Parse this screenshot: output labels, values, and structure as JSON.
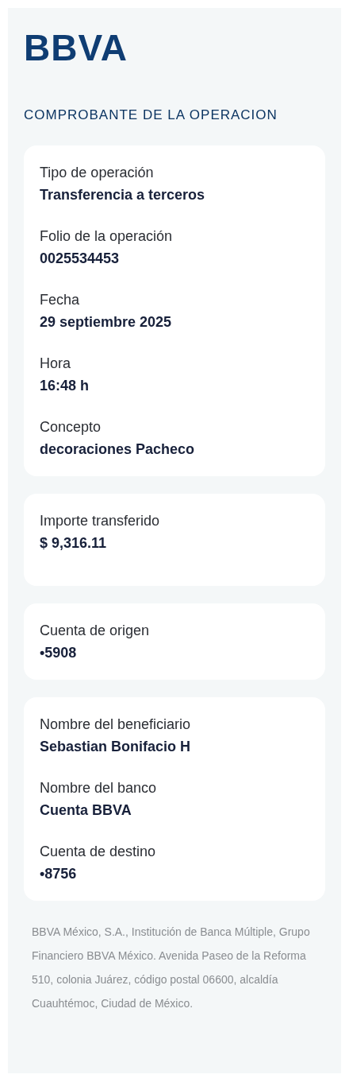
{
  "logo": "BBVA",
  "title": "COMPROBANTE DE LA OPERACION",
  "cards": [
    {
      "fields": [
        {
          "label": "Tipo de operación",
          "value": "Transferencia a terceros"
        },
        {
          "label": "Folio de la operación",
          "value": "0025534453"
        },
        {
          "label": "Fecha",
          "value": "29 septiembre 2025"
        },
        {
          "label": "Hora",
          "value": "16:48 h"
        },
        {
          "label": "Concepto",
          "value": "decoraciones Pacheco"
        }
      ]
    },
    {
      "fields": [
        {
          "label": "Importe transferido",
          "value": "$ 9,316.11"
        }
      ]
    },
    {
      "fields": [
        {
          "label": "Cuenta de origen",
          "value": "•5908"
        }
      ]
    },
    {
      "fields": [
        {
          "label": "Nombre del beneficiario",
          "value": "Sebastian Bonifacio H"
        },
        {
          "label": "Nombre del banco",
          "value": "Cuenta BBVA"
        },
        {
          "label": "Cuenta de destino",
          "value": "•8756"
        }
      ]
    }
  ],
  "footer": "BBVA México, S.A., Institución de Banca Múltiple, Grupo Financiero BBVA México. Avenida Paseo de la Reforma 510, colonia Juárez, código postal 06600, alcaldía Cuauhtémoc, Ciudad de México."
}
